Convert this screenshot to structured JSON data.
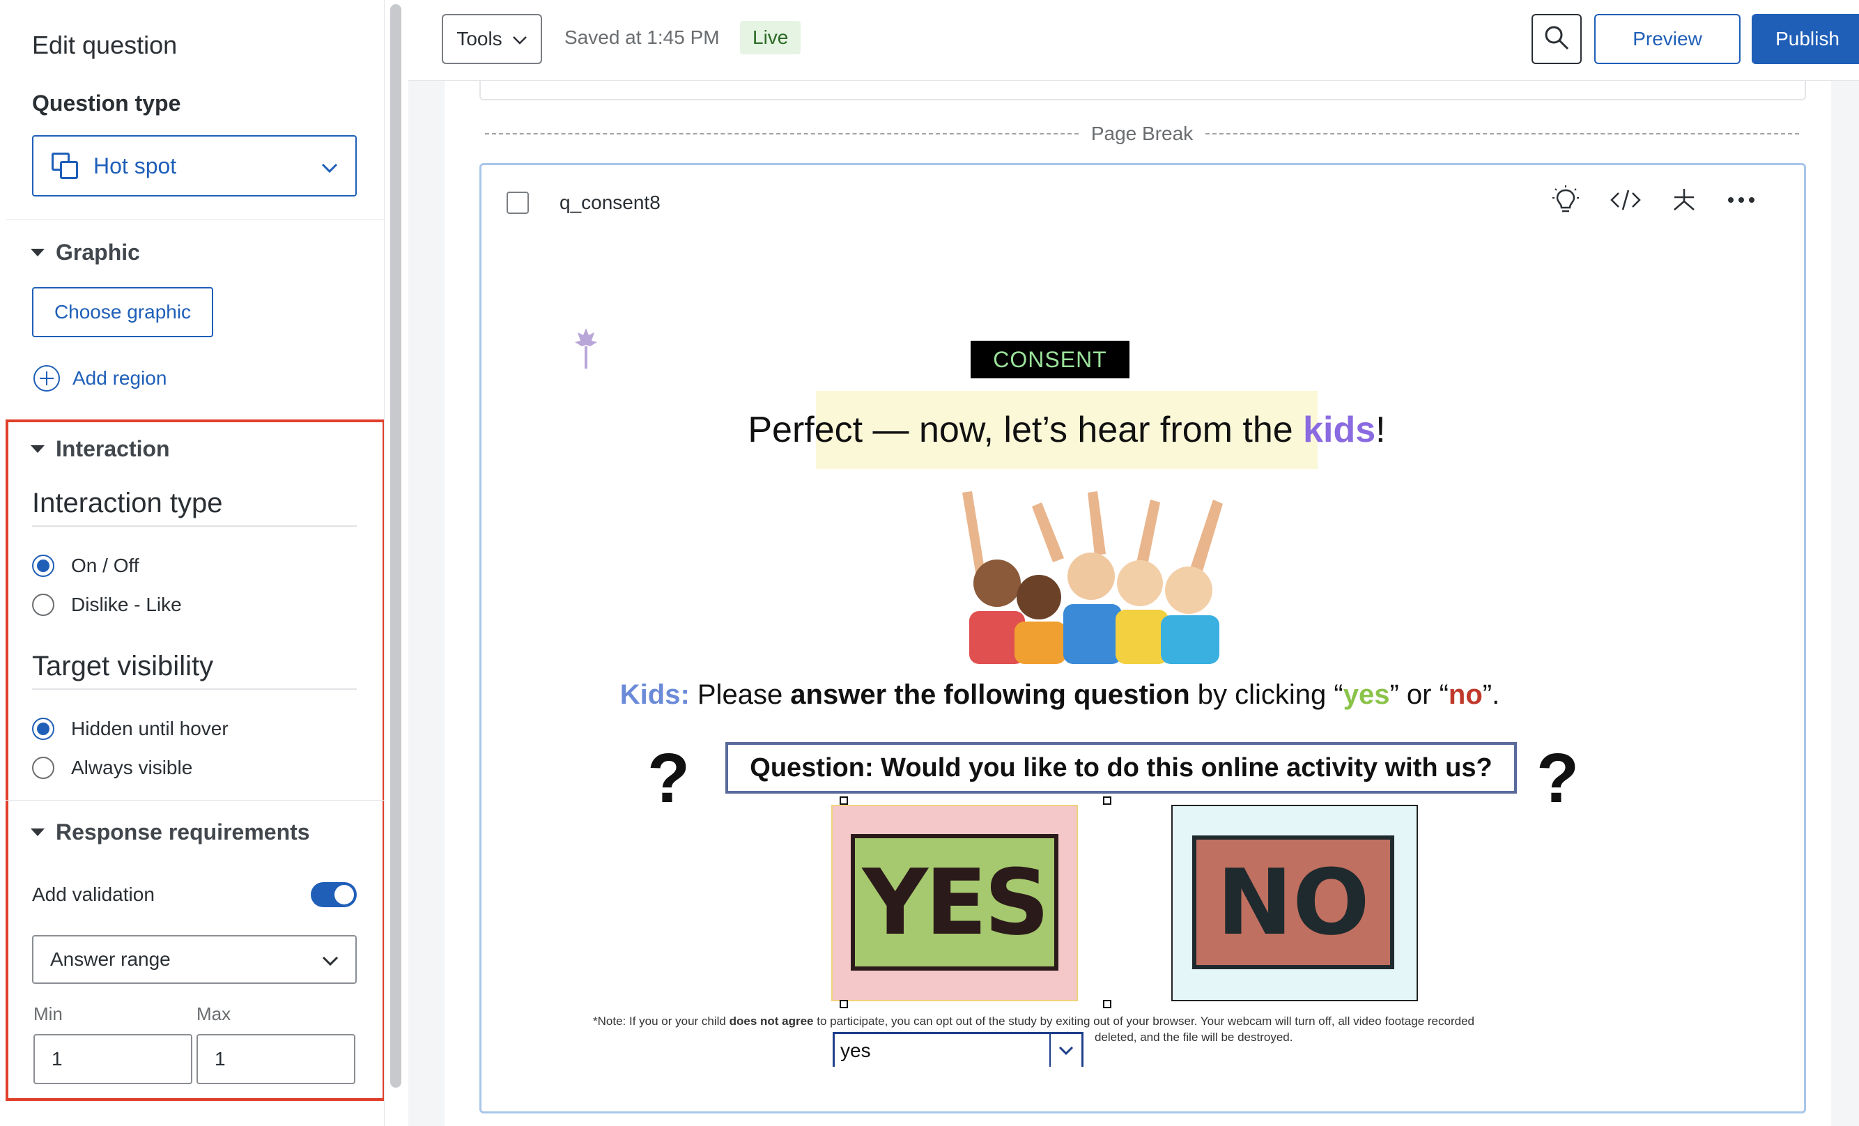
{
  "sidebar": {
    "title": "Edit question",
    "question_type_label": "Question type",
    "question_type_value": "Hot spot",
    "graphic_section": "Graphic",
    "choose_graphic": "Choose graphic",
    "add_region": "Add region",
    "interaction_section": "Interaction",
    "interaction_type_label": "Interaction type",
    "interaction_options": [
      "On / Off",
      "Dislike - Like"
    ],
    "interaction_selected": "On / Off",
    "target_visibility_label": "Target visibility",
    "visibility_options": [
      "Hidden until hover",
      "Always visible"
    ],
    "visibility_selected": "Hidden until hover",
    "response_section": "Response requirements",
    "add_validation_label": "Add validation",
    "add_validation_on": true,
    "validation_type": "Answer range",
    "min_label": "Min",
    "max_label": "Max",
    "min_value": "1",
    "max_value": "1"
  },
  "topbar": {
    "tools_label": "Tools",
    "saved_text": "Saved at 1:45 PM",
    "status_badge": "Live",
    "preview_label": "Preview",
    "publish_label": "Publish"
  },
  "survey": {
    "page_break_label": "Page Break",
    "question_id": "q_consent8"
  },
  "graphic": {
    "consent_label": "CONSENT",
    "banner_prefix": "Perfect — now, let’s hear from the ",
    "banner_kids": "kids",
    "banner_suffix": "!",
    "kids_prefix": "Kids:",
    "kids_text1": " Please ",
    "kids_bold": "answer the following question",
    "kids_text2": " by clicking “",
    "kids_yes": "yes",
    "kids_text3": "” or “",
    "kids_no": "no",
    "kids_text4": "”.",
    "question_text": "Question: Would you like to do this online activity with us?",
    "yes_label": "YES",
    "no_label": "NO",
    "note_text1": "*Note: If you or your child ",
    "note_bold": "does not agree",
    "note_text2": " to participate, you can opt out of the study by exiting out of your browser. Your webcam will turn off, all video footage recorded",
    "note_text3": "deleted, and the file will be destroyed.",
    "region_dropdown_value": "yes"
  },
  "colors": {
    "accent": "#1f5fb8",
    "highlight_border": "#e0402b",
    "live_badge_bg": "#e6f4e4",
    "kids_purple": "#8a6ae0",
    "yes_green": "#a6c86e",
    "no_red": "#c07060"
  },
  "icons": {
    "question_type": "hotspot-icon",
    "tools_chevron": "chevron-down-icon",
    "search": "search-icon",
    "question_tools": [
      "lightbulb-icon",
      "code-icon",
      "asterisk-icon",
      "more-icon"
    ]
  }
}
